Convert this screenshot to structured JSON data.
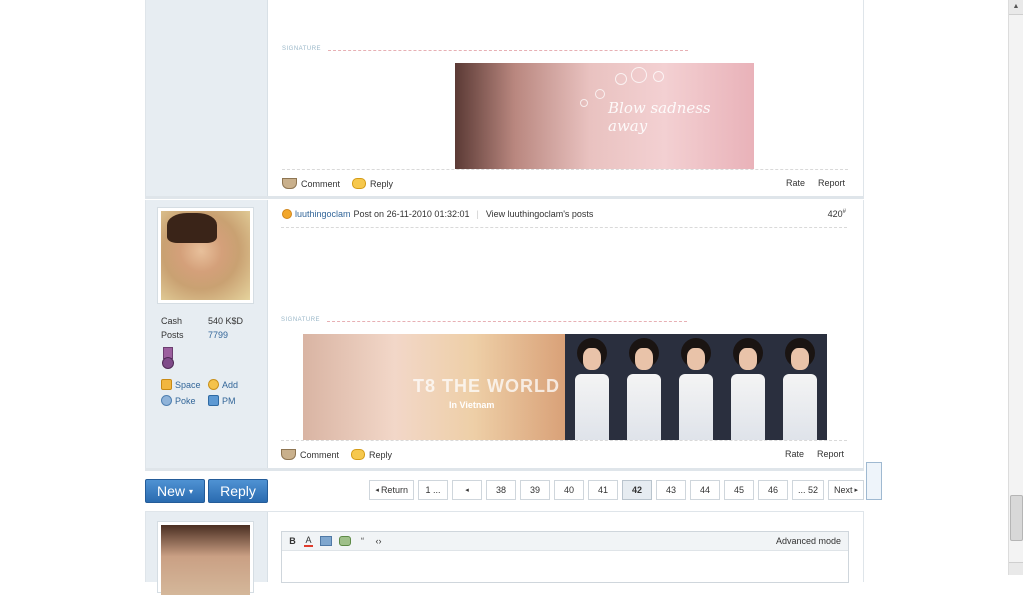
{
  "post1": {
    "signature_label": "SIGNATURE",
    "signature_text": "Blow sadness away",
    "comment": "Comment",
    "reply": "Reply",
    "rate": "Rate",
    "report": "Report"
  },
  "post2": {
    "author": "luuthingoclam",
    "posted_on": "Post on 26-11-2010 01:32:01",
    "view_posts": "View luuthingoclam's posts",
    "floor": "420",
    "floor_suffix": "#",
    "stats": [
      {
        "label": "Cash",
        "value": "540 K$D"
      },
      {
        "label": "Posts",
        "value": "7799"
      }
    ],
    "links": {
      "space": "Space",
      "add": "Add",
      "poke": "Poke",
      "pm": "PM"
    },
    "signature_label": "SIGNATURE",
    "sig_text1": "T8 THE WORLD",
    "sig_text2": "In Vietnam",
    "comment": "Comment",
    "reply": "Reply",
    "rate": "Rate",
    "report": "Report"
  },
  "toolbar": {
    "new_label": "New",
    "reply_label": "Reply"
  },
  "pager": {
    "return": "Return",
    "first": "1 ...",
    "pages": [
      "38",
      "39",
      "40",
      "41",
      "42",
      "43",
      "44",
      "45",
      "46"
    ],
    "current": "42",
    "last": "... 52",
    "next": "Next"
  },
  "editor": {
    "advanced_mode": "Advanced mode"
  },
  "colors": {
    "link": "#336699",
    "button": "#2a6bb0",
    "sidebar": "#e7edf2"
  }
}
